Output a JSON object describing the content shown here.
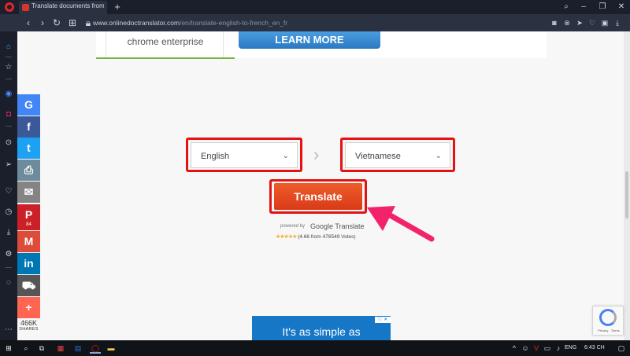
{
  "colors": {
    "browser_dark": "#1a1f2b",
    "highlight_red": "#e31313",
    "translate_orange": "#e24a1f",
    "arrow_pink": "#f2236a",
    "learn_more_blue": "#2b78c2"
  },
  "browser": {
    "tab_title": "Translate documents from",
    "new_tab": "+",
    "url_host": "www.onlinedoctranslator.com",
    "url_path": "/en/translate-english-to-french_en_fr",
    "icons": [
      "back-icon",
      "forward-icon",
      "reload-icon",
      "tabs-grid-icon",
      "lock-icon",
      "camera-icon",
      "close-circle-icon",
      "send-icon",
      "heart-icon",
      "box-icon",
      "download-icon",
      "menu-icon"
    ]
  },
  "sidebar": {
    "icons": [
      "home-icon",
      "star-icon",
      "messenger-icon",
      "instagram-icon",
      "player-icon",
      "send-icon",
      "heart-icon",
      "history-icon",
      "download-icon",
      "settings-icon",
      "lightbulb-icon",
      "more-icon"
    ]
  },
  "ads": {
    "top_card_text": "chrome enterprise",
    "learn_more": "LEARN MORE",
    "bottom_text": "It's as simple as"
  },
  "share": {
    "buttons": [
      {
        "glyph": "G",
        "name": "google",
        "color": "#4285f4"
      },
      {
        "glyph": "f",
        "name": "facebook",
        "color": "#3b5998"
      },
      {
        "glyph": "t",
        "name": "twitter",
        "color": "#1da1f2"
      },
      {
        "glyph": "⎙",
        "name": "print",
        "color": "#6d8b9c"
      },
      {
        "glyph": "✉",
        "name": "email",
        "color": "#848484"
      },
      {
        "glyph": "P",
        "name": "pinterest",
        "color": "#cb2027"
      },
      {
        "glyph": "M",
        "name": "gmail",
        "color": "#dd4b39"
      },
      {
        "glyph": "in",
        "name": "linkedin",
        "color": "#0077b5"
      },
      {
        "glyph": "⛟",
        "name": "delivery",
        "color": "#565656"
      },
      {
        "glyph": "+",
        "name": "more",
        "color": "#ff6550"
      }
    ],
    "pinterest_count": "84",
    "total": "466K",
    "total_label": "SHARES"
  },
  "translator": {
    "source_language": "English",
    "target_language": "Vietnamese",
    "translate_label": "Translate",
    "powered_by": "powered by",
    "google_translate": "Google Translate",
    "stars": "★★★★★",
    "rating_text": "(4.66 from 478549 Votes)"
  },
  "recaptcha": {
    "terms": "Privacy - Terms"
  },
  "taskbar": {
    "language": "ENG",
    "time": "6:43 CH"
  }
}
